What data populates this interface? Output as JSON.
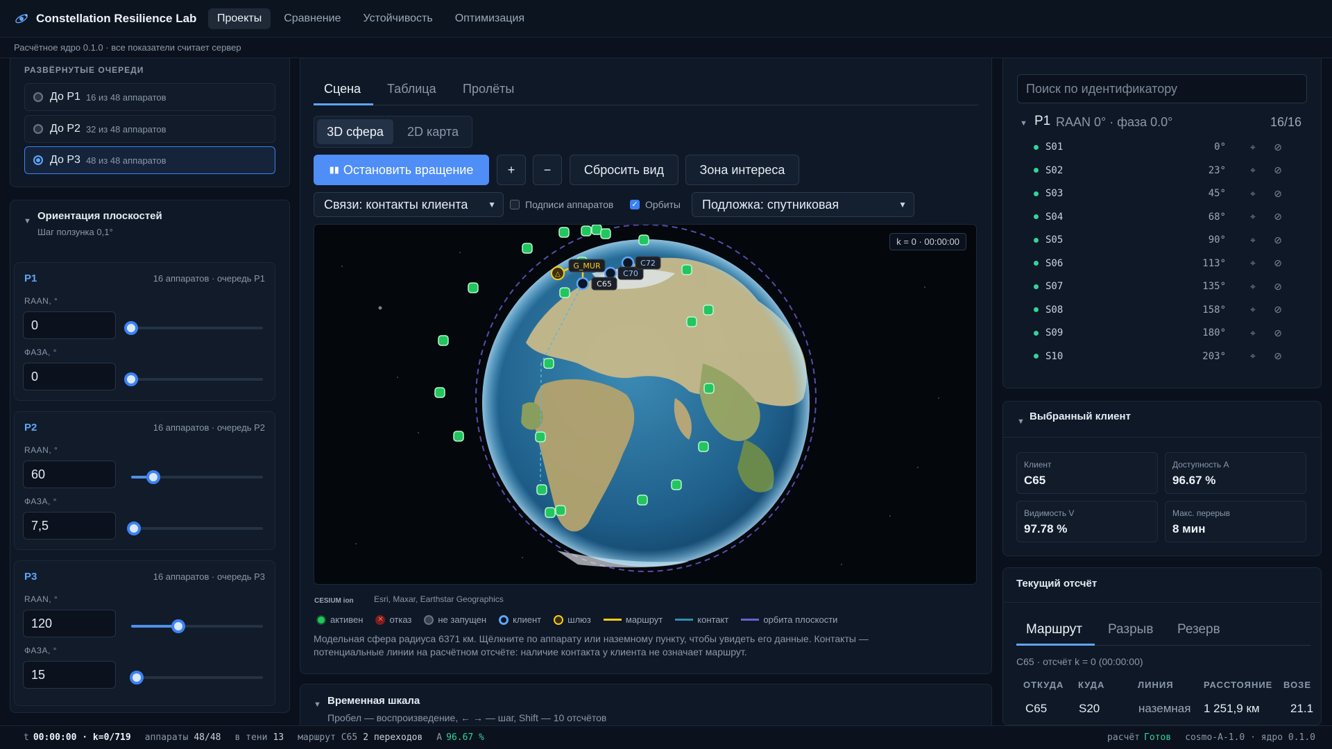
{
  "app": {
    "title": "Constellation Resilience Lab"
  },
  "nav": {
    "tabs": [
      "Проекты",
      "Сравнение",
      "Устойчивость",
      "Оптимизация"
    ]
  },
  "subbar": {
    "text": "Расчётное ядро 0.1.0 · все показатели считает сервер"
  },
  "left": {
    "queues_title": "РАЗВЁРНУТЫЕ ОЧЕРЕДИ",
    "queues": [
      {
        "label": "До P1",
        "sub": "16 из 48 аппаратов",
        "selected": false
      },
      {
        "label": "До P2",
        "sub": "32 из 48 аппаратов",
        "selected": false
      },
      {
        "label": "До P3",
        "sub": "48 из 48 аппаратов",
        "selected": true
      }
    ],
    "orientation_title": "Ориентация плоскостей",
    "orientation_sub": "Шаг ползунка 0,1°",
    "raan_label": "RAAN, °",
    "phase_label": "ФАЗА, °",
    "planes": [
      {
        "name": "P1",
        "meta": "16 аппаратов · очередь P1",
        "raan": "0",
        "phase": "0",
        "raan_frac": 0.0,
        "phase_frac": 0.0
      },
      {
        "name": "P2",
        "meta": "16 аппаратов · очередь P2",
        "raan": "60",
        "phase": "7,5",
        "raan_frac": 0.17,
        "phase_frac": 0.02
      },
      {
        "name": "P3",
        "meta": "16 аппаратов · очередь P3",
        "raan": "120",
        "phase": "15",
        "raan_frac": 0.36,
        "phase_frac": 0.04
      }
    ]
  },
  "center": {
    "tabs": [
      "Сцена",
      "Таблица",
      "Пролёты"
    ],
    "view_tabs": [
      "3D сфера",
      "2D карта"
    ],
    "buttons": {
      "stop": "Остановить вращение",
      "plus": "+",
      "minus": "−",
      "reset": "Сбросить вид",
      "zone": "Зона интереса"
    },
    "links_select": "Связи: контакты клиента",
    "chk_labels": "Подписи аппаратов",
    "chk_orbits": "Орбиты",
    "base_select": "Подложка: спутниковая",
    "scene_counter": "k = 0 · 00:00:00",
    "labels": {
      "gw": "G_MUR",
      "c65": "C65",
      "c70": "C70",
      "c72": "C72"
    },
    "attribution": "Esri, Maxar, Earthstar Geographics",
    "cesium": "CESIUM ion",
    "legend": [
      "активен",
      "отказ",
      "не запущен",
      "клиент",
      "шлюз",
      "маршрут",
      "контакт",
      "орбита плоскости"
    ],
    "note": "Модельная сфера радиуса 6371 км. Щёлкните по аппарату или наземному пункту, чтобы увидеть его данные. Контакты — потенциальные линии на расчётном отсчёте: наличие контакта у клиента не означает маршрут.",
    "timeline_title": "Временная шкала",
    "timeline_sub": "Пробел — воспроизведение, ← → — шаг, Shift — 10 отсчётов"
  },
  "right": {
    "search_placeholder": "Поиск по идентификатору",
    "group": {
      "name": "P1",
      "desc": "RAAN 0° · фаза 0.0°",
      "count": "16/16"
    },
    "sats": [
      {
        "id": "S01",
        "ang": "0°"
      },
      {
        "id": "S02",
        "ang": "23°"
      },
      {
        "id": "S03",
        "ang": "45°"
      },
      {
        "id": "S04",
        "ang": "68°"
      },
      {
        "id": "S05",
        "ang": "90°"
      },
      {
        "id": "S06",
        "ang": "113°"
      },
      {
        "id": "S07",
        "ang": "135°"
      },
      {
        "id": "S08",
        "ang": "158°"
      },
      {
        "id": "S09",
        "ang": "180°"
      },
      {
        "id": "S10",
        "ang": "203°"
      }
    ],
    "client_title": "Выбранный клиент",
    "stats": [
      {
        "label": "Клиент",
        "value": "C65"
      },
      {
        "label": "Доступность A",
        "value": "96.67 %"
      },
      {
        "label": "Видимость V",
        "value": "97.78 %"
      },
      {
        "label": "Макс. перерыв",
        "value": "8 мин"
      }
    ],
    "current_title": "Текущий отсчёт",
    "route_tabs": [
      "Маршрут",
      "Разрыв",
      "Резерв"
    ],
    "route_sub": "C65 · отсчёт k = 0 (00:00:00)",
    "columns": [
      "ОТКУДА",
      "КУДА",
      "ЛИНИЯ",
      "РАССТОЯНИЕ",
      "ВОЗЕ"
    ],
    "row": [
      "C65",
      "S20",
      "наземная",
      "1 251,9 км",
      "21.1"
    ]
  },
  "status": {
    "t_label": "t",
    "t": "00:00:00 · k=0/719",
    "sats_label": "аппараты",
    "sats": "48/48",
    "shadow_label": "в тени",
    "shadow": "13",
    "route_label": "маршрут C65",
    "route": "2 переходов",
    "a_label": "A",
    "a": "96.67 %",
    "calc_label": "расчёт",
    "calc": "Готов",
    "version": "cosmo-A-1.0 · ядро 0.1.0"
  }
}
